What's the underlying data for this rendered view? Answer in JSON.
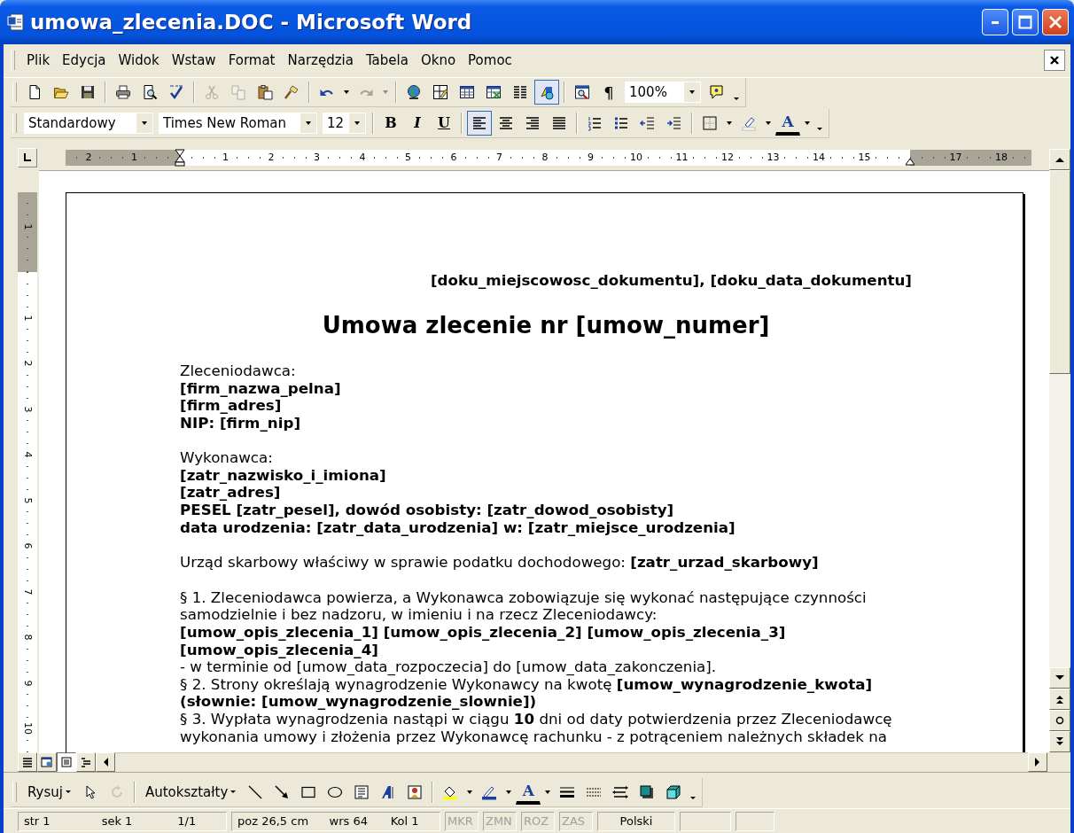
{
  "window": {
    "title": "umowa_zlecenia.DOC - Microsoft Word"
  },
  "menu": [
    "Plik",
    "Edycja",
    "Widok",
    "Wstaw",
    "Format",
    "Narzędzia",
    "Tabela",
    "Okno",
    "Pomoc"
  ],
  "standard_toolbar": [
    {
      "kind": "icon",
      "disabled": false,
      "pressed": false
    },
    {
      "kind": "icon",
      "disabled": false,
      "pressed": false
    },
    {
      "kind": "icon",
      "disabled": false,
      "pressed": false
    },
    {
      "kind": "separator"
    },
    {
      "kind": "icon",
      "disabled": false,
      "pressed": false
    },
    {
      "kind": "icon",
      "disabled": false,
      "pressed": false
    },
    {
      "kind": "icon",
      "disabled": false,
      "pressed": false
    },
    {
      "kind": "separator"
    },
    {
      "kind": "icon",
      "disabled": true,
      "pressed": false
    },
    {
      "kind": "icon",
      "disabled": true,
      "pressed": false
    },
    {
      "kind": "icon",
      "disabled": false,
      "pressed": false
    },
    {
      "kind": "icon",
      "disabled": false,
      "pressed": false
    },
    {
      "kind": "separator"
    },
    {
      "kind": "icon",
      "disabled": false,
      "pressed": false
    },
    {
      "kind": "icon",
      "disabled": false,
      "pressed": false
    },
    {
      "kind": "icon",
      "disabled": true,
      "pressed": false
    },
    {
      "kind": "icon",
      "disabled": true,
      "pressed": false
    },
    {
      "kind": "separator"
    },
    {
      "kind": "icon",
      "disabled": false,
      "pressed": false
    },
    {
      "kind": "icon",
      "disabled": false,
      "pressed": false
    },
    {
      "kind": "icon",
      "disabled": false,
      "pressed": false
    },
    {
      "kind": "icon",
      "disabled": false,
      "pressed": false
    },
    {
      "kind": "icon",
      "disabled": false,
      "pressed": false
    },
    {
      "kind": "icon",
      "disabled": false,
      "pressed": true
    },
    {
      "kind": "separator"
    },
    {
      "kind": "icon",
      "disabled": false,
      "pressed": false
    },
    {
      "kind": "text",
      "text": "¶",
      "pressed": false
    },
    {
      "kind": "combo",
      "value": "100%"
    },
    {
      "kind": "icon",
      "disabled": false,
      "pressed": false
    },
    {
      "kind": "icon",
      "disabled": false,
      "pressed": false
    }
  ],
  "formatting_toolbar": [
    {
      "kind": "combo",
      "value": "Standardowy"
    },
    {
      "kind": "combo",
      "value": "Times New Roman"
    },
    {
      "kind": "combo",
      "value": "12"
    },
    {
      "kind": "separator"
    },
    {
      "kind": "text",
      "text": "B",
      "pressed": false
    },
    {
      "kind": "text",
      "text": "I",
      "pressed": false
    },
    {
      "kind": "text",
      "text": "U",
      "pressed": false
    },
    {
      "kind": "separator"
    },
    {
      "kind": "icon",
      "disabled": false,
      "pressed": true
    },
    {
      "kind": "icon",
      "disabled": false,
      "pressed": false
    },
    {
      "kind": "icon",
      "disabled": false,
      "pressed": false
    },
    {
      "kind": "icon",
      "disabled": false,
      "pressed": false
    },
    {
      "kind": "separator"
    },
    {
      "kind": "icon",
      "disabled": false,
      "pressed": false
    },
    {
      "kind": "icon",
      "disabled": false,
      "pressed": false
    },
    {
      "kind": "icon",
      "disabled": false,
      "pressed": false
    },
    {
      "kind": "icon",
      "disabled": false,
      "pressed": false
    },
    {
      "kind": "separator"
    },
    {
      "kind": "icon",
      "disabled": false,
      "pressed": false
    },
    {
      "kind": "icon",
      "disabled": false,
      "pressed": false
    },
    {
      "kind": "icon",
      "disabled": false,
      "pressed": false
    },
    {
      "kind": "icon",
      "disabled": false,
      "pressed": false
    },
    {
      "kind": "text",
      "text": "A",
      "pressed": false
    },
    {
      "kind": "icon",
      "disabled": false,
      "pressed": false
    },
    {
      "kind": "icon",
      "disabled": false,
      "pressed": false
    }
  ],
  "ruler": {
    "left_margin_numbers": [
      "2",
      "1"
    ],
    "numbers": [
      "1",
      "2",
      "3",
      "4",
      "5",
      "6",
      "7",
      "8",
      "9",
      "10",
      "11",
      "12",
      "13",
      "14",
      "15"
    ],
    "right_margin_numbers": [
      "17",
      "18"
    ]
  },
  "vertical_ruler": {
    "top_margin_numbers": [
      "1"
    ],
    "numbers": [
      "1",
      "2",
      "3",
      "4",
      "5",
      "6",
      "7",
      "8",
      "9",
      "10"
    ]
  },
  "document": {
    "header": "[doku_miejscowosc_dokumentu], [doku_data_dokumentu]",
    "title": "Umowa zlecenie nr [umow_numer]",
    "lines": [
      {
        "text": "Zleceniodawca:",
        "bold": false,
        "gap": false
      },
      {
        "text": "[firm_nazwa_pelna]",
        "bold": true,
        "gap": false
      },
      {
        "text": "[firm_adres]",
        "bold": true,
        "gap": false
      },
      {
        "text": "NIP: [firm_nip]",
        "bold": true,
        "gap": false
      },
      {
        "text": "Wykonawca:",
        "bold": false,
        "gap": true
      },
      {
        "text": "[zatr_nazwisko_i_imiona]",
        "bold": true,
        "gap": false
      },
      {
        "text": "[zatr_adres]",
        "bold": true,
        "gap": false
      },
      {
        "text": "PESEL [zatr_pesel], dowód osobisty: [zatr_dowod_osobisty]",
        "bold": true,
        "gap": false
      },
      {
        "text": "data urodzenia: [zatr_data_urodzenia] w: [zatr_miejsce_urodzenia]",
        "bold": true,
        "gap": false
      },
      {
        "text": "Urząd skarbowy właściwy w sprawie podatku dochodowego: **[zatr_urzad_skarbowy]**",
        "bold": false,
        "gap": true
      },
      {
        "text": "§ 1. Zleceniodawca powierza, a Wykonawca zobowiązuje się wykonać następujące czynności",
        "bold": false,
        "gap": true
      },
      {
        "text": "samodzielnie i bez nadzoru, w imieniu i na rzecz Zleceniodawcy:",
        "bold": false,
        "gap": false
      },
      {
        "text": "[umow_opis_zlecenia_1] [umow_opis_zlecenia_2] [umow_opis_zlecenia_3]",
        "bold": true,
        "gap": false
      },
      {
        "text": "[umow_opis_zlecenia_4]",
        "bold": true,
        "gap": false
      },
      {
        "text": "- w terminie od [umow_data_rozpoczecia] do [umow_data_zakonczenia].",
        "bold": false,
        "gap": false
      },
      {
        "text": "§ 2. Strony określają wynagrodzenie Wykonawcy na kwotę **[umow_wynagrodzenie_kwota]**",
        "bold": false,
        "gap": false
      },
      {
        "text": "(słownie: [umow_wynagrodzenie_slownie])",
        "bold": true,
        "gap": false
      },
      {
        "text": "§ 3. Wypłata wynagrodzenia nastąpi w ciągu **10** dni od daty potwierdzenia przez Zleceniodawcę",
        "bold": false,
        "gap": false
      },
      {
        "text": "wykonania umowy i złożenia przez Wykonawcę rachunku - z potrąceniem należnych składek na",
        "bold": false,
        "gap": false
      }
    ]
  },
  "view_buttons": [
    {
      "selected": false
    },
    {
      "selected": false
    },
    {
      "selected": true
    },
    {
      "selected": false
    }
  ],
  "drawing_toolbar": [
    {
      "kind": "menu",
      "text": "Rysuj"
    },
    {
      "kind": "icon",
      "disabled": false,
      "pressed": false
    },
    {
      "kind": "icon",
      "disabled": true,
      "pressed": false
    },
    {
      "kind": "separator"
    },
    {
      "kind": "menu",
      "text": "Autokształty"
    },
    {
      "kind": "icon",
      "disabled": false,
      "pressed": false
    },
    {
      "kind": "icon",
      "disabled": false,
      "pressed": false
    },
    {
      "kind": "icon",
      "disabled": false,
      "pressed": false
    },
    {
      "kind": "icon",
      "disabled": false,
      "pressed": false
    },
    {
      "kind": "icon",
      "disabled": false,
      "pressed": false
    },
    {
      "kind": "icon",
      "disabled": false,
      "pressed": false
    },
    {
      "kind": "icon",
      "disabled": false,
      "pressed": false
    },
    {
      "kind": "separator"
    },
    {
      "kind": "icon",
      "disabled": false,
      "pressed": false
    },
    {
      "kind": "icon",
      "disabled": false,
      "pressed": false
    },
    {
      "kind": "icon",
      "disabled": false,
      "pressed": false
    },
    {
      "kind": "icon",
      "disabled": false,
      "pressed": false
    },
    {
      "kind": "text",
      "text": "A",
      "pressed": false
    },
    {
      "kind": "icon",
      "disabled": false,
      "pressed": false
    },
    {
      "kind": "icon",
      "disabled": false,
      "pressed": false
    },
    {
      "kind": "icon",
      "disabled": false,
      "pressed": false
    },
    {
      "kind": "icon",
      "disabled": false,
      "pressed": false
    },
    {
      "kind": "icon",
      "disabled": false,
      "pressed": false
    },
    {
      "kind": "icon",
      "disabled": false,
      "pressed": false
    },
    {
      "kind": "icon",
      "disabled": false,
      "pressed": false
    }
  ],
  "status_bar": {
    "position": [
      "str 1",
      "sek 1",
      "1/1"
    ],
    "cursor": [
      "poz 26,5 cm",
      "wrs 64",
      "Kol 1"
    ],
    "modes": [
      {
        "text": "MKR",
        "disabled": true
      },
      {
        "text": "ZMN",
        "disabled": true
      },
      {
        "text": "ROZ",
        "disabled": true
      },
      {
        "text": "ZAS",
        "disabled": true
      }
    ],
    "language": "Polski"
  }
}
